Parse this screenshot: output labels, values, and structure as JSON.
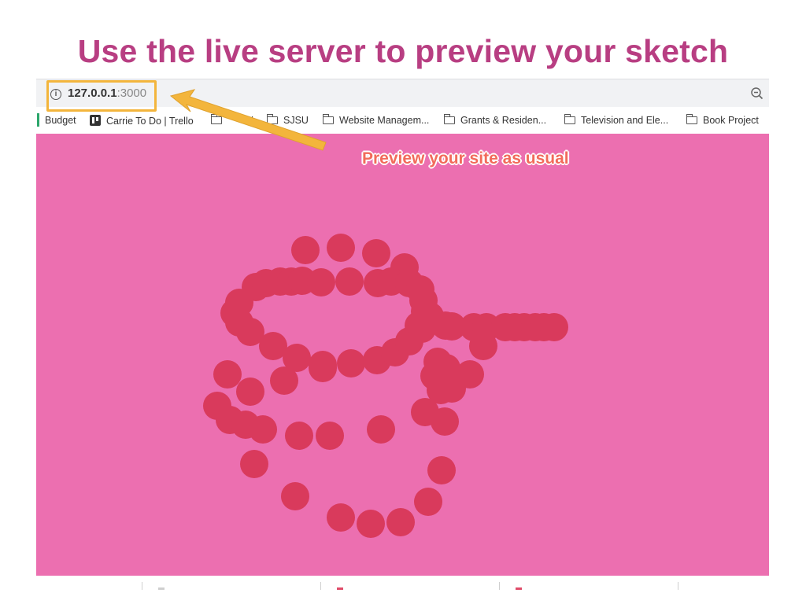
{
  "slide": {
    "title": "Use the live server to preview your sketch"
  },
  "address_bar": {
    "info_icon": "info-icon",
    "host": "127.0.0.1",
    "port": ":3000",
    "zoom_icon": "zoom-out-icon"
  },
  "bookmarks": [
    {
      "label": "Budget",
      "icon": "none"
    },
    {
      "label": "Carrie To Do | Trello",
      "icon": "trello-icon"
    },
    {
      "label": "N",
      "icon": "folder-icon"
    },
    {
      "label": "SJSU",
      "icon": "folder-icon"
    },
    {
      "label": "Website Managem...",
      "icon": "folder-icon"
    },
    {
      "label": "Grants & Residen...",
      "icon": "folder-icon"
    },
    {
      "label": "Television and Ele...",
      "icon": "folder-icon"
    },
    {
      "label": "Book Project",
      "icon": "folder-icon"
    }
  ],
  "viewport": {
    "background": "#ec6fb0",
    "dot_color": "#d93a5c",
    "callout": "Preview your site as usual"
  },
  "colors": {
    "title": "#b83e82",
    "highlight": "#f3b53c",
    "arrow": "#f3b53c",
    "callout_text": "#f26a5a"
  }
}
